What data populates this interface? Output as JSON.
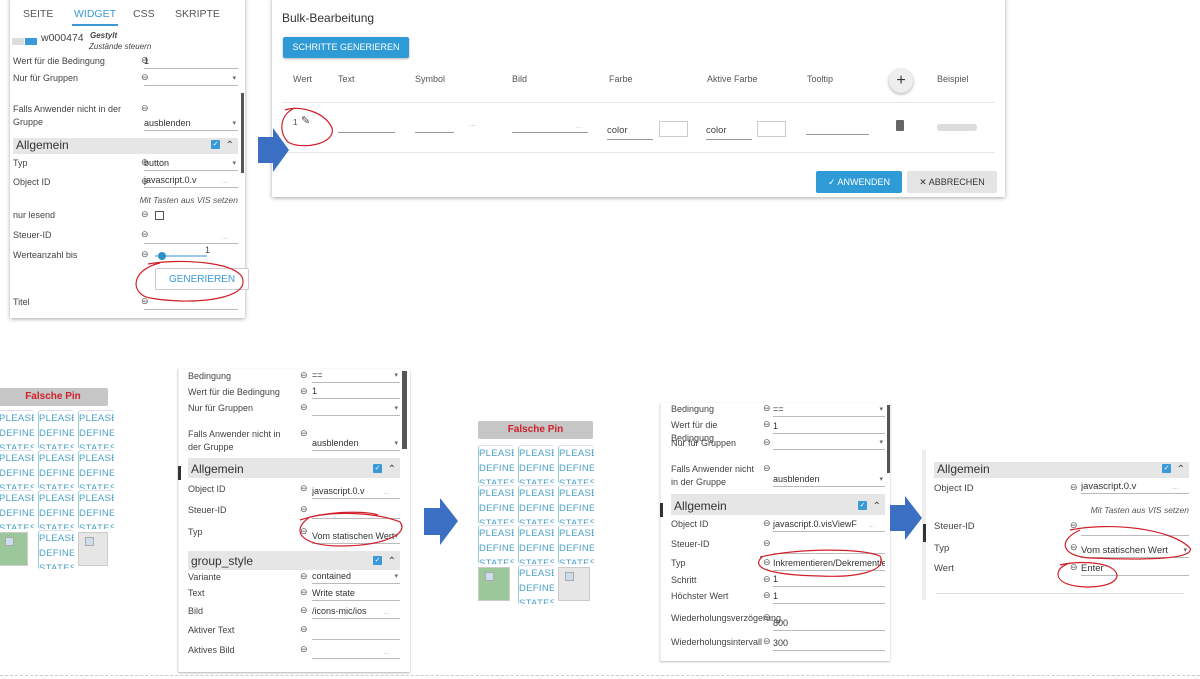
{
  "panel_a": {
    "tabs": [
      "SEITE",
      "WIDGET",
      "CSS",
      "SKRIPTE"
    ],
    "active_tab": "WIDGET",
    "widget_id": "w000474",
    "widget_set": "Gestylt",
    "widget_name": "Zustände steuern",
    "rows": [
      {
        "label": "Wert für die Bedingung",
        "value": "1",
        "kind": "input"
      },
      {
        "label": "Nur für Gruppen",
        "value": "",
        "kind": "select"
      },
      {
        "label": "Falls Anwender nicht in der Gruppe",
        "value": "ausblenden",
        "kind": "select"
      },
      {
        "kind": "header",
        "label": "Allgemein"
      },
      {
        "label": "Typ",
        "value": "button",
        "kind": "select"
      },
      {
        "label": "Object ID",
        "value": "javascript.0.v",
        "kind": "dots",
        "hint": "Mit Tasten aus VIS setzen"
      },
      {
        "label": "nur lesend",
        "kind": "checkbox",
        "value": ""
      },
      {
        "label": "Steuer-ID",
        "value": "",
        "kind": "dots"
      },
      {
        "label": "Werteanzahl bis",
        "value": "1",
        "kind": "slider",
        "slider_fraction": 0.05
      },
      {
        "kind": "button",
        "label": "GENERIEREN"
      },
      {
        "label": "Titel",
        "value": "",
        "kind": "input"
      }
    ]
  },
  "dialog": {
    "title": "Bulk-Bearbeitung",
    "generate_button": "SCHRITTE GENERIEREN",
    "columns": [
      "Wert",
      "Text",
      "Symbol",
      "Bild",
      "Farbe",
      "Aktive Farbe",
      "Tooltip",
      "Beispiel"
    ],
    "add_icon": "plus-icon",
    "row": {
      "wert": "1",
      "farbe": "color",
      "aktive_farbe": "color",
      "dots": "..."
    },
    "apply_button": "ANWENDEN",
    "cancel_button": "ABBRECHEN",
    "accent": "#2e9bd6"
  },
  "widgets": {
    "pin_button": "Falsche Pin",
    "line1": "PLEASE",
    "line2": "DEFINE",
    "line3": "STATES"
  },
  "panel_b": {
    "rows": [
      {
        "label": "Bedingung",
        "value": "==",
        "kind": "select"
      },
      {
        "label": "Wert für die Bedingung",
        "value": "1",
        "kind": "input"
      },
      {
        "label": "Nur für Gruppen",
        "value": "",
        "kind": "select"
      },
      {
        "label": "Falls Anwender nicht in der Gruppe",
        "value": "ausblenden",
        "kind": "select"
      },
      {
        "kind": "header",
        "label": "Allgemein"
      },
      {
        "label": "Object ID",
        "value": "javascript.0.v",
        "kind": "dots"
      },
      {
        "label": "Steuer-ID",
        "value": "",
        "kind": "input"
      },
      {
        "label": "Typ",
        "value": "Vom statischen Wert",
        "kind": "select"
      },
      {
        "kind": "header",
        "label": "group_style"
      },
      {
        "label": "Variante",
        "value": "contained",
        "kind": "select"
      },
      {
        "label": "Text",
        "value": "Write state",
        "kind": "input"
      },
      {
        "label": "Bild",
        "value": "/icons-mic/ios",
        "kind": "dots"
      },
      {
        "label": "Aktiver Text",
        "value": "",
        "kind": "input"
      },
      {
        "label": "Aktives Bild",
        "value": "",
        "kind": "dots"
      }
    ]
  },
  "panel_c": {
    "rows": [
      {
        "label": "Bedingung",
        "value": "==",
        "kind": "select"
      },
      {
        "label": "Wert für die Bedingung",
        "value": "1",
        "kind": "input"
      },
      {
        "label": "Nur für Gruppen",
        "value": "",
        "kind": "select"
      },
      {
        "label": "Falls Anwender nicht in der Gruppe",
        "value": "ausblenden",
        "kind": "select"
      },
      {
        "kind": "header",
        "label": "Allgemein"
      },
      {
        "label": "Object ID",
        "value": "javascript.0.visViewF",
        "kind": "dots"
      },
      {
        "label": "Steuer-ID",
        "value": "",
        "kind": "input"
      },
      {
        "label": "Typ",
        "value": "Inkrementieren/Dekrementieren",
        "kind": "input"
      },
      {
        "label": "Schritt",
        "value": "1",
        "kind": "input"
      },
      {
        "label": "Höchster Wert",
        "value": "1",
        "kind": "input"
      },
      {
        "label": "Wiederholungsverzögerung",
        "value": "800",
        "kind": "input"
      },
      {
        "label": "Wiederholungsintervall",
        "value": "300",
        "kind": "input"
      }
    ]
  },
  "panel_d": {
    "rows": [
      {
        "kind": "header",
        "label": "Allgemein"
      },
      {
        "label": "Object ID",
        "value": "javascript.0.v",
        "kind": "dots",
        "hint": "Mit Tasten aus VIS setzen"
      },
      {
        "label": "Steuer-ID",
        "value": "",
        "kind": "input"
      },
      {
        "label": "Typ",
        "value": "Vom statischen Wert",
        "kind": "select"
      },
      {
        "label": "Wert",
        "value": "Enter",
        "kind": "input"
      }
    ]
  },
  "annotation_color": "#d0202a",
  "arrow_color": "#3b6fc4"
}
